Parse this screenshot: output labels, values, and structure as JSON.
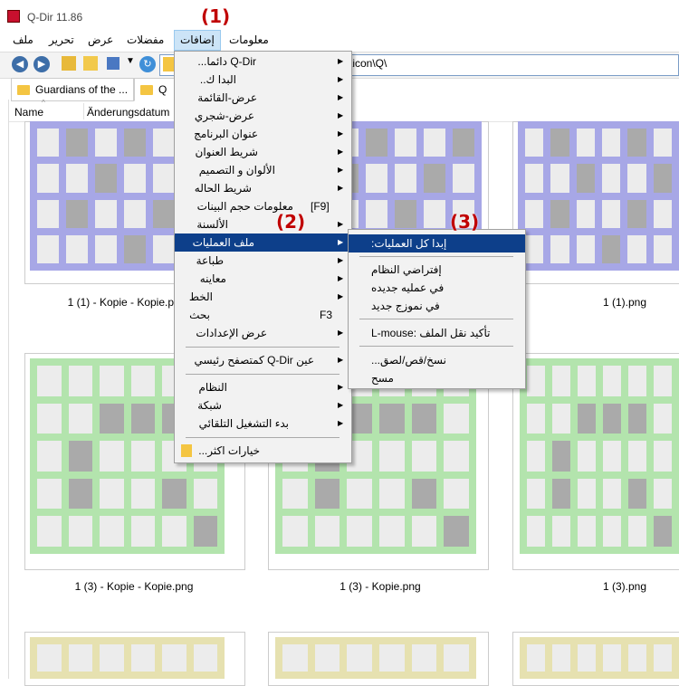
{
  "window": {
    "title": "Q-Dir 11.86"
  },
  "menubar": {
    "items": [
      "ملف",
      "تحرير",
      "عرض",
      "مفضلات",
      "إضافات",
      "معلومات"
    ]
  },
  "toolbar": {
    "path": "\\icon\\Q\\"
  },
  "tabs": [
    {
      "label": "Guardians of the ..."
    },
    {
      "label": "Q"
    }
  ],
  "columns": {
    "name": "Name",
    "date": "Änderungsdatum"
  },
  "files": [
    {
      "caption": "1 (1) - Kopie - Kopie.png",
      "color": "blue"
    },
    {
      "caption": "",
      "color": "blue"
    },
    {
      "caption": "1 (1).png",
      "color": "blue"
    },
    {
      "caption": "1 (3) - Kopie - Kopie.png",
      "color": "green"
    },
    {
      "caption": "1 (3) - Kopie.png",
      "color": "green"
    },
    {
      "caption": "1 (3).png",
      "color": "green"
    }
  ],
  "menu1": {
    "items": [
      {
        "label": "Q-Dir دائما...",
        "arrow": true
      },
      {
        "label": "البدا ك..",
        "arrow": true
      },
      {
        "label": "عرض-القائمة",
        "arrow": true
      },
      {
        "label": "عرض-شجري",
        "arrow": true
      },
      {
        "label": "عنوان البرنامج",
        "arrow": true
      },
      {
        "label": "شريط العنوان",
        "arrow": true
      },
      {
        "label": "الألوان و التصميم",
        "arrow": true
      },
      {
        "label": "شريط الحاله",
        "arrow": true
      },
      {
        "label": "معلومات حجم البينات",
        "shortcut": "[F9]"
      },
      {
        "label": "الألسنة",
        "arrow": true
      },
      {
        "label": "ملف العمليات",
        "arrow": true,
        "highlight": true
      },
      {
        "label": "طباعة",
        "arrow": true
      },
      {
        "label": "معاينه",
        "arrow": true
      },
      {
        "label": "الخط",
        "arrow": true
      },
      {
        "label": "بحث",
        "shortcut": "F3"
      },
      {
        "label": "عرض الإعدادات",
        "arrow": true
      },
      {
        "label": "عين Q-Dir كمتصفح رئيسي",
        "arrow": true
      },
      {
        "label": "النظام",
        "arrow": true
      },
      {
        "label": "شبكة",
        "arrow": true
      },
      {
        "label": "بدء التشغيل التلقائي",
        "arrow": true
      },
      {
        "label": "خيارات اكثر..."
      }
    ]
  },
  "menu2": {
    "items": [
      {
        "label": "إبدا كل العمليات:",
        "highlight": true
      },
      {
        "label": "إفتراضي النظام"
      },
      {
        "label": "في عمليه جديده"
      },
      {
        "label": "في نموزج جديد"
      },
      {
        "label": "تأكيد نقل الملف :L-mouse"
      },
      {
        "label": "نسخ/قص/لصق..."
      },
      {
        "label": "مسح"
      }
    ]
  },
  "annotations": [
    "(1)",
    "(2)",
    "(3)"
  ]
}
